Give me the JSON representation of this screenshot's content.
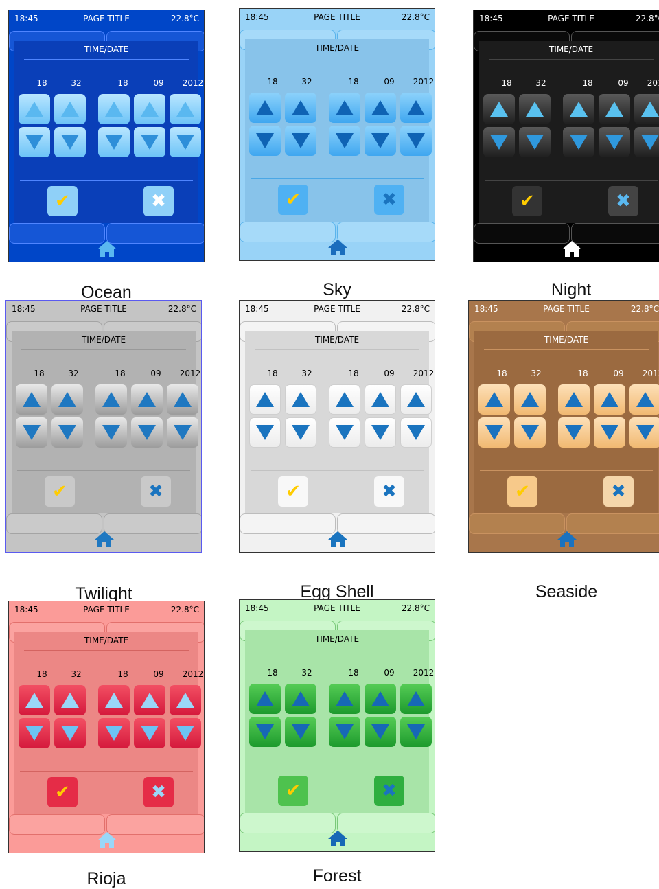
{
  "screen": {
    "status_time": "18:45",
    "page_title": "PAGE TITLE",
    "temperature": "22.8°C",
    "section_title": "TIME/DATE",
    "values": [
      "18",
      "32",
      "18",
      "09",
      "2012"
    ]
  },
  "icons": {
    "up": "up-arrow-icon",
    "down": "down-arrow-icon",
    "confirm": "checkmark-icon",
    "cancel": "x-mark-icon",
    "home": "home-icon"
  },
  "themes": [
    {
      "name": "Ocean",
      "bg": "#0046c8",
      "panel": "#0a3fb8",
      "tab": "#1556d6",
      "tabBorder": "#4f85ff",
      "text": "#ffffff",
      "rule": "#4f85ff",
      "btnTop": "#b9e6ff",
      "btnBot": "#6cc3f7",
      "arrow": "#5ab8f0",
      "arrowDark": "#2e8fd9",
      "checkBg": "#8fd0f8",
      "xBg": "#8fd0f8",
      "home": "#5ab8f0",
      "nameTop": 412
    },
    {
      "name": "Sky",
      "bg": "#99d3f7",
      "panel": "#88c3ea",
      "tab": "#a6daf9",
      "tabBorder": "#5ab4ec",
      "text": "#000000",
      "rule": "#4aa7e6",
      "btnTop": "#8dd2fb",
      "btnBot": "#3fa7f0",
      "arrow": "#0f63b4",
      "arrowDark": "#0f63b4",
      "checkBg": "#4fb1f3",
      "xBg": "#4fb1f3",
      "home": "#1a6dbd",
      "nameTop": 408
    },
    {
      "name": "Night",
      "bg": "#000000",
      "panel": "#1c1c1c",
      "tab": "#0a0a0a",
      "tabBorder": "#555555",
      "text": "#ffffff",
      "rule": "#444444",
      "btnTop": "#5a5a5a",
      "btnBot": "#1f1f1f",
      "arrow": "#59c1ef",
      "arrowDark": "#2f98dd",
      "checkBg": "#333333",
      "xBg": "#444444",
      "home": "#ffffff",
      "nameTop": 408
    },
    {
      "name": "Twilight",
      "bg": "#c4c4c4",
      "panel": "#b2b2b2",
      "tab": "#cacaca",
      "tabBorder": "#a4a4a4",
      "text": "#000000",
      "rule": "#999999",
      "btnTop": "#e8e8e8",
      "btnBot": "#9c9c9c",
      "arrow": "#1f78c1",
      "arrowDark": "#1f78c1",
      "checkBg": "#c9c9c9",
      "xBg": "#c9c9c9",
      "home": "#1f78c1",
      "nameTop": 851
    },
    {
      "name": "Egg Shell",
      "bg": "#f1f1f1",
      "panel": "#d8d8d8",
      "tab": "#f4f4f4",
      "tabBorder": "#bdbdbd",
      "text": "#000000",
      "rule": "#c2c2c2",
      "btnTop": "#ffffff",
      "btnBot": "#ececec",
      "arrow": "#1a74bf",
      "arrowDark": "#1a74bf",
      "checkBg": "#f8f8f8",
      "xBg": "#f8f8f8",
      "home": "#1a74bf",
      "nameTop": 848
    },
    {
      "name": "Seaside",
      "bg": "#a8764b",
      "panel": "#9b6a40",
      "tab": "#b3814f",
      "tabBorder": "#c99260",
      "text": "#ffffff",
      "rule": "#c99260",
      "btnTop": "#fde0b8",
      "btnBot": "#f1b972",
      "arrow": "#1a72bf",
      "arrowDark": "#1a72bf",
      "checkBg": "#f7c98a",
      "xBg": "#f5d6aa",
      "home": "#1a72bf",
      "nameTop": 848
    },
    {
      "name": "Rioja",
      "bg": "#fb9b98",
      "panel": "#ec8785",
      "tab": "#fba3a0",
      "tabBorder": "#e2706c",
      "text": "#000000",
      "rule": "#d46461",
      "btnTop": "#f24f63",
      "btnBot": "#d5193c",
      "arrow": "#9ad7f8",
      "arrowDark": "#6cc3f4",
      "checkBg": "#e52c47",
      "xBg": "#e52c47",
      "home": "#9ad7f8",
      "nameTop": 1266
    },
    {
      "name": "Forest",
      "bg": "#c4f5c4",
      "panel": "#a8e4a8",
      "tab": "#cdf7cd",
      "tabBorder": "#7ac97a",
      "text": "#000000",
      "rule": "#6fb86f",
      "btnTop": "#55cc55",
      "btnBot": "#1d9a2d",
      "arrow": "#1768b6",
      "arrowDark": "#1768b6",
      "checkBg": "#4ec24e",
      "xBg": "#2fae3f",
      "home": "#1768b6",
      "nameTop": 1262
    }
  ]
}
